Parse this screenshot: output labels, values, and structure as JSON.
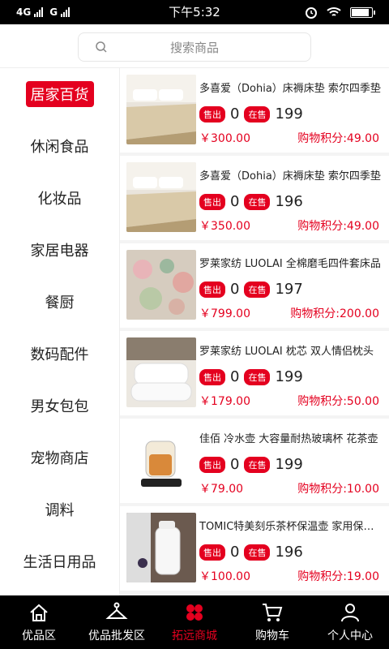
{
  "status": {
    "network": "4G",
    "network2": "G",
    "time": "下午5:32",
    "battery": 0.9
  },
  "search": {
    "placeholder": "搜索商品"
  },
  "categories": [
    {
      "label": "居家百货",
      "active": true
    },
    {
      "label": "休闲食品",
      "active": false
    },
    {
      "label": "化妆品",
      "active": false
    },
    {
      "label": "家居电器",
      "active": false
    },
    {
      "label": "餐厨",
      "active": false
    },
    {
      "label": "数码配件",
      "active": false
    },
    {
      "label": "男女包包",
      "active": false
    },
    {
      "label": "宠物商店",
      "active": false
    },
    {
      "label": "调料",
      "active": false
    },
    {
      "label": "生活日用品",
      "active": false
    }
  ],
  "products": [
    {
      "title": "多喜爱（Dohia）床褥床垫 索尔四季垫",
      "sold_label": "售出",
      "sold": "0",
      "onsale_label": "在售",
      "onsale": "199",
      "price": "￥300.00",
      "points": "购物积分:49.00",
      "thumb": "mattress"
    },
    {
      "title": "多喜爱（Dohia）床褥床垫 索尔四季垫",
      "sold_label": "售出",
      "sold": "0",
      "onsale_label": "在售",
      "onsale": "196",
      "price": "￥350.00",
      "points": "购物积分:49.00",
      "thumb": "mattress"
    },
    {
      "title": "罗莱家纺 LUOLAI 全棉磨毛四件套床品",
      "sold_label": "售出",
      "sold": "0",
      "onsale_label": "在售",
      "onsale": "197",
      "price": "￥799.00",
      "points": "购物积分:200.00",
      "thumb": "floral"
    },
    {
      "title": "罗莱家纺 LUOLAI 枕芯 双人情侣枕头",
      "sold_label": "售出",
      "sold": "0",
      "onsale_label": "在售",
      "onsale": "199",
      "price": "￥179.00",
      "points": "购物积分:50.00",
      "thumb": "pillow"
    },
    {
      "title": "佳佰 冷水壶 大容量耐热玻璃杯 花茶壶",
      "sold_label": "售出",
      "sold": "0",
      "onsale_label": "在售",
      "onsale": "199",
      "price": "￥79.00",
      "points": "购物积分:10.00",
      "thumb": "kettle"
    },
    {
      "title": "TOMIC特美刻乐茶杯保温壶 家用保温瓶",
      "sold_label": "售出",
      "sold": "0",
      "onsale_label": "在售",
      "onsale": "196",
      "price": "￥100.00",
      "points": "购物积分:19.00",
      "thumb": "flask"
    }
  ],
  "nav": [
    {
      "label": "优品区",
      "icon": "home-icon",
      "active": false
    },
    {
      "label": "优品批发区",
      "icon": "hanger-icon",
      "active": false
    },
    {
      "label": "拓远商城",
      "icon": "mall-icon",
      "active": true
    },
    {
      "label": "购物车",
      "icon": "cart-icon",
      "active": false
    },
    {
      "label": "个人中心",
      "icon": "user-icon",
      "active": false
    }
  ],
  "colors": {
    "accent": "#e4001f",
    "nav_bg": "#000000"
  }
}
